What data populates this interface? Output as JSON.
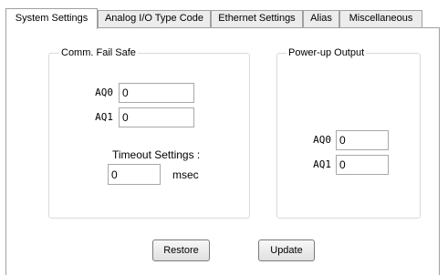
{
  "tabs": [
    {
      "label": "System Settings",
      "active": true
    },
    {
      "label": "Analog I/O Type Code",
      "active": false
    },
    {
      "label": "Ethernet Settings",
      "active": false
    },
    {
      "label": "Alias",
      "active": false
    },
    {
      "label": "Miscellaneous",
      "active": false
    }
  ],
  "comm_fail_safe": {
    "title": "Comm. Fail Safe",
    "aq0_label": "AQ0",
    "aq0_value": "0",
    "aq1_label": "AQ1",
    "aq1_value": "0",
    "timeout_label": "Timeout Settings :",
    "timeout_value": "0",
    "timeout_unit": "msec"
  },
  "power_up_output": {
    "title": "Power-up Output",
    "aq0_label": "AQ0",
    "aq0_value": "0",
    "aq1_label": "AQ1",
    "aq1_value": "0"
  },
  "buttons": {
    "restore": "Restore",
    "update": "Update"
  }
}
